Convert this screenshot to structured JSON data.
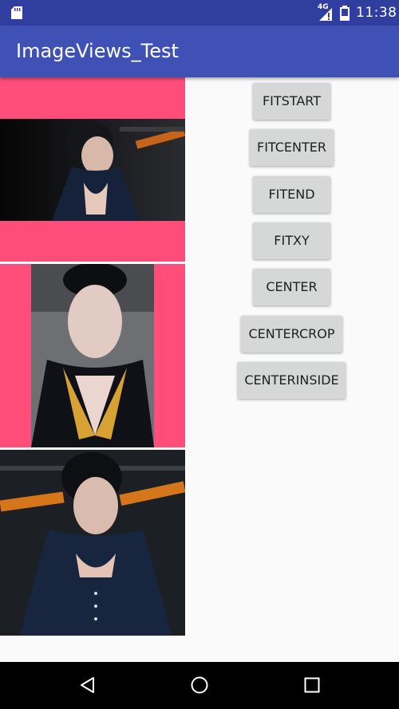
{
  "status_bar": {
    "network_label": "4G",
    "time": "11:38",
    "icons": [
      "sd-card-icon",
      "signal-icon",
      "battery-icon"
    ]
  },
  "app_bar": {
    "title": "ImageViews_Test",
    "color": "#3f51b5"
  },
  "image_views": [
    {
      "scale_type_shown": "fit-start",
      "background": "#ff4d7a"
    },
    {
      "scale_type_shown": "fit-center",
      "background": "#ff4d7a"
    },
    {
      "scale_type_shown": "fit-xy",
      "background": "#ff4d7a"
    }
  ],
  "buttons": [
    {
      "label": "FITSTART"
    },
    {
      "label": "FITCENTER"
    },
    {
      "label": "FITEND"
    },
    {
      "label": "FITXY"
    },
    {
      "label": "CENTER"
    },
    {
      "label": "CENTERCROP"
    },
    {
      "label": "CENTERINSIDE"
    }
  ],
  "nav_bar": {
    "icons": [
      "back-icon",
      "home-icon",
      "recents-icon"
    ]
  }
}
